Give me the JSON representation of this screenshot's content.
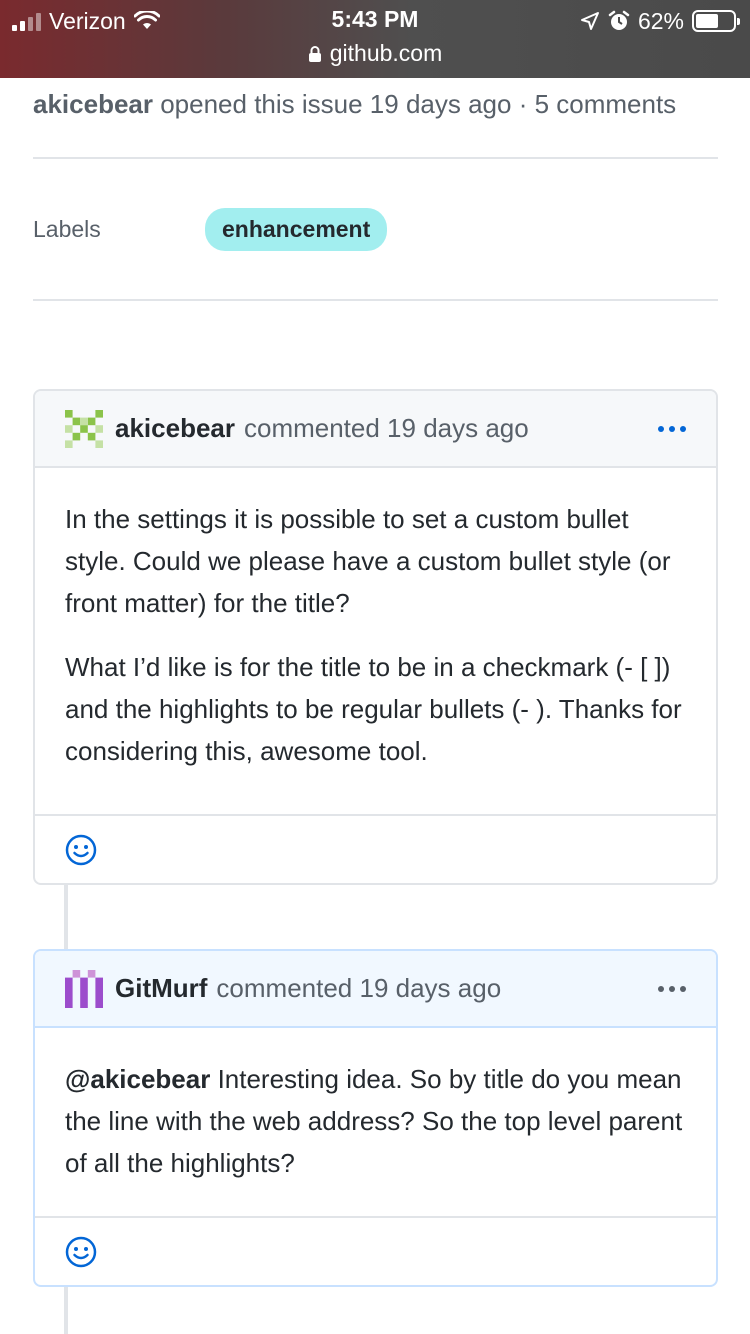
{
  "status_bar": {
    "carrier": "Verizon",
    "time": "5:43 PM",
    "url": "github.com",
    "battery_percent": "62%",
    "battery_level": 0.62
  },
  "issue": {
    "author": "akicebear",
    "opened_text": "opened this issue 19 days ago · 5 comments"
  },
  "labels": {
    "title": "Labels",
    "items": [
      {
        "name": "enhancement",
        "color": "#a2eeef"
      }
    ]
  },
  "comments": [
    {
      "user": "akicebear",
      "meta": "commented 19 days ago",
      "paragraphs": [
        "In the settings it is possible to set a custom bullet style. Could we please have a custom bullet style (or front matter) for the title?",
        "What I’d like is for the title to be in a checkmark (- [ ]) and the highlights to be regular bullets (- ). Thanks for considering this, awesome tool."
      ]
    },
    {
      "user": "GitMurf",
      "meta": "commented 19 days ago",
      "mention": "@akicebear",
      "text": " Interesting idea. So by title do you mean the line with the web address? So the top level parent of all the highlights?"
    }
  ],
  "colors": {
    "link_blue": "#0366d6",
    "label_bg": "#a2eeef",
    "border": "#e1e4e8",
    "owner_header": "#f1f8ff"
  },
  "icons": [
    "signal-icon",
    "wifi-icon",
    "lock-icon",
    "location-arrow-icon",
    "alarm-icon",
    "battery-icon",
    "kebab-menu-icon",
    "smiley-reaction-icon"
  ]
}
